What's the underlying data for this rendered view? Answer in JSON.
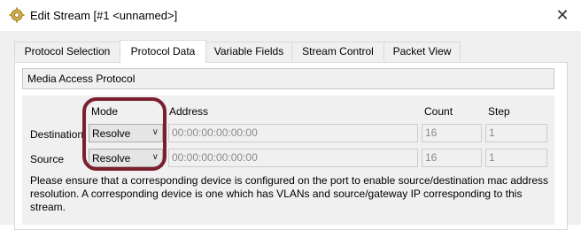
{
  "window": {
    "title": "Edit Stream [#1 <unnamed>]",
    "close_label": "✕"
  },
  "tabs": [
    {
      "label": "Protocol Selection",
      "active": false
    },
    {
      "label": "Protocol Data",
      "active": true
    },
    {
      "label": "Variable Fields",
      "active": false
    },
    {
      "label": "Stream Control",
      "active": false
    },
    {
      "label": "Packet View",
      "active": false
    }
  ],
  "section": {
    "title": "Media Access Protocol"
  },
  "columns": {
    "mode": "Mode",
    "address": "Address",
    "count": "Count",
    "step": "Step"
  },
  "rows": [
    {
      "label": "Destination",
      "mode": "Resolve",
      "address": "00:00:00:00:00:00",
      "count": "16",
      "step": "1"
    },
    {
      "label": "Source",
      "mode": "Resolve",
      "address": "00:00:00:00:00:00",
      "count": "16",
      "step": "1"
    }
  ],
  "note": "Please ensure that a corresponding device is configured on the port to enable source/destination mac address resolution. A corresponding device is one which has VLANs and source/gateway IP corresponding to this stream.",
  "colors": {
    "highlight": "#7a1f2e"
  }
}
